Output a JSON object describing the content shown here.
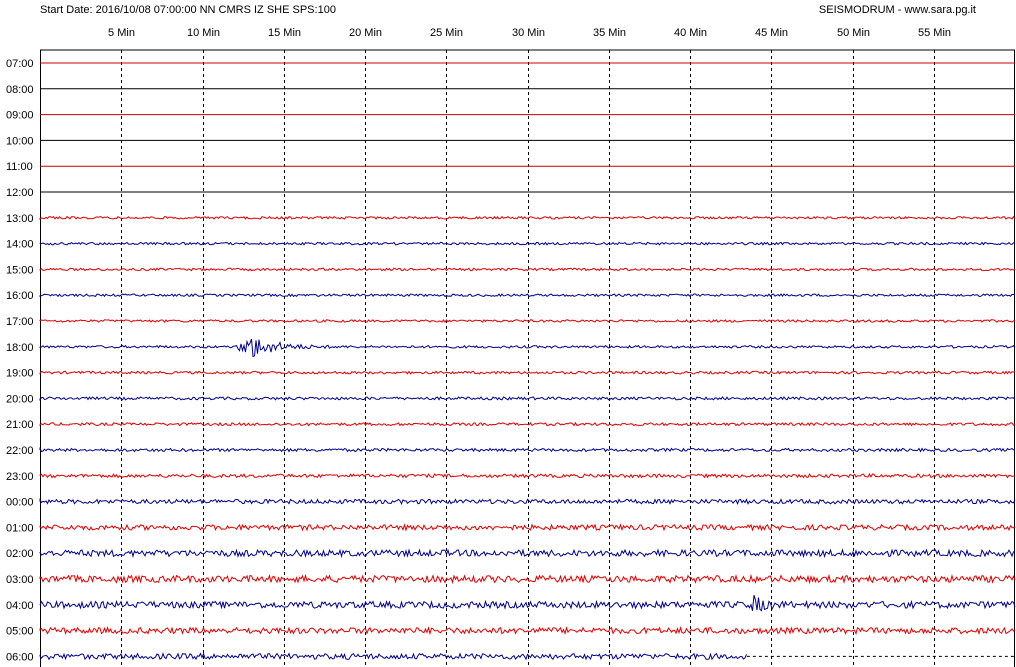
{
  "header": {
    "start_info": "Start Date: 2016/10/08 07:00:00 NN CMRS IZ SHE SPS:100",
    "credit": "SEISMODRUM - www.sara.pg.it"
  },
  "minute_labels": [
    "5 Min",
    "10 Min",
    "15 Min",
    "20 Min",
    "25 Min",
    "30 Min",
    "35 Min",
    "40 Min",
    "45 Min",
    "50 Min",
    "55 Min"
  ],
  "rows": [
    {
      "label": "07:00",
      "color": "#cc0000",
      "noise": 0,
      "trace_end_min": 60
    },
    {
      "label": "08:00",
      "color": "#000000",
      "noise": 0,
      "trace_end_min": 60
    },
    {
      "label": "09:00",
      "color": "#cc0000",
      "noise": 0,
      "trace_end_min": 60
    },
    {
      "label": "10:00",
      "color": "#000000",
      "noise": 0,
      "trace_end_min": 60
    },
    {
      "label": "11:00",
      "color": "#cc0000",
      "noise": 0,
      "trace_end_min": 60
    },
    {
      "label": "12:00",
      "color": "#000000",
      "noise": 0,
      "trace_end_min": 60
    },
    {
      "label": "13:00",
      "color": "#dd0000",
      "noise": 1.2,
      "trace_end_min": 60
    },
    {
      "label": "14:00",
      "color": "#00008b",
      "noise": 1.2,
      "trace_end_min": 60
    },
    {
      "label": "15:00",
      "color": "#dd0000",
      "noise": 1.2,
      "trace_end_min": 60
    },
    {
      "label": "16:00",
      "color": "#00008b",
      "noise": 1.2,
      "trace_end_min": 60
    },
    {
      "label": "17:00",
      "color": "#dd0000",
      "noise": 1.2,
      "trace_end_min": 60
    },
    {
      "label": "18:00",
      "color": "#00008b",
      "noise": 1.2,
      "trace_end_min": 60,
      "event": {
        "start_min": 12,
        "end_min": 19,
        "peak": 11
      }
    },
    {
      "label": "19:00",
      "color": "#dd0000",
      "noise": 1.3,
      "trace_end_min": 60
    },
    {
      "label": "20:00",
      "color": "#00008b",
      "noise": 1.4,
      "trace_end_min": 60
    },
    {
      "label": "21:00",
      "color": "#dd0000",
      "noise": 1.4,
      "trace_end_min": 60
    },
    {
      "label": "22:00",
      "color": "#00008b",
      "noise": 1.5,
      "trace_end_min": 60
    },
    {
      "label": "23:00",
      "color": "#dd0000",
      "noise": 1.7,
      "trace_end_min": 60
    },
    {
      "label": "00:00",
      "color": "#00008b",
      "noise": 2.2,
      "trace_end_min": 60
    },
    {
      "label": "01:00",
      "color": "#dd0000",
      "noise": 2.6,
      "trace_end_min": 60
    },
    {
      "label": "02:00",
      "color": "#00008b",
      "noise": 3.2,
      "trace_end_min": 60
    },
    {
      "label": "03:00",
      "color": "#dd0000",
      "noise": 3.4,
      "trace_end_min": 60
    },
    {
      "label": "04:00",
      "color": "#00008b",
      "noise": 3.3,
      "trace_end_min": 60,
      "event": {
        "start_min": 43.5,
        "end_min": 46.5,
        "peak": 7
      }
    },
    {
      "label": "05:00",
      "color": "#dd0000",
      "noise": 3.0,
      "trace_end_min": 60
    },
    {
      "label": "06:00",
      "color": "#00008b",
      "noise": 2.8,
      "trace_end_min": 43.5
    }
  ]
}
